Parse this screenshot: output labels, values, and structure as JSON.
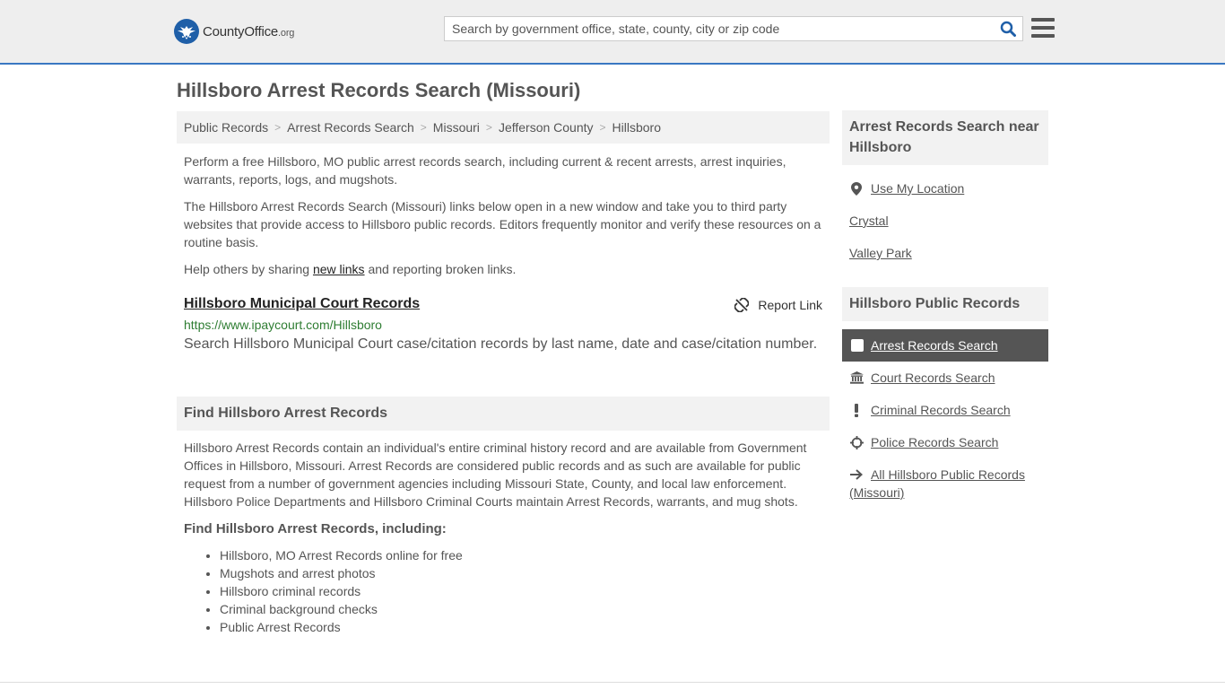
{
  "header": {
    "logo_text": "CountyOffice",
    "logo_tld": ".org",
    "search_placeholder": "Search by government office, state, county, city or zip code"
  },
  "page": {
    "title": "Hillsboro Arrest Records Search (Missouri)"
  },
  "breadcrumb": [
    "Public Records",
    "Arrest Records Search",
    "Missouri",
    "Jefferson County",
    "Hillsboro"
  ],
  "intro": {
    "p1": "Perform a free Hillsboro, MO public arrest records search, including current & recent arrests, arrest inquiries, warrants, reports, logs, and mugshots.",
    "p2": "The Hillsboro Arrest Records Search (Missouri) links below open in a new window and take you to third party websites that provide access to Hillsboro public records. Editors frequently monitor and verify these resources on a routine basis.",
    "p3_before": "Help others by sharing ",
    "p3_link": "new links",
    "p3_after": " and reporting broken links."
  },
  "result": {
    "title": "Hillsboro Municipal Court Records",
    "report_label": "Report Link",
    "url": "https://www.ipaycourt.com/Hillsboro",
    "description": "Search Hillsboro Municipal Court case/citation records by last name, date and case/citation number."
  },
  "find_section": {
    "heading": "Find Hillsboro Arrest Records",
    "body": "Hillsboro Arrest Records contain an individual's entire criminal history record and are available from Government Offices in Hillsboro, Missouri. Arrest Records are considered public records and as such are available for public request from a number of government agencies including Missouri State, County, and local law enforcement. Hillsboro Police Departments and Hillsboro Criminal Courts maintain Arrest Records, warrants, and mug shots.",
    "subheading": "Find Hillsboro Arrest Records, including:",
    "items": [
      "Hillsboro, MO Arrest Records online for free",
      "Mugshots and arrest photos",
      "Hillsboro criminal records",
      "Criminal background checks",
      "Public Arrest Records"
    ]
  },
  "sidebar": {
    "near_heading": "Arrest Records Search near Hillsboro",
    "use_location": "Use My Location",
    "near_items": [
      "Crystal",
      "Valley Park"
    ],
    "public_heading": "Hillsboro Public Records",
    "active_item": "Arrest Records Search",
    "items": [
      "Court Records Search",
      "Criminal Records Search",
      "Police Records Search",
      "All Hillsboro Public Records (Missouri)"
    ]
  },
  "colors": {
    "brand_blue": "#1f5fa8",
    "header_border": "#3a78c2",
    "url_green": "#2e7d32",
    "active_bg": "#555555"
  },
  "icons": {
    "search": "search-icon",
    "menu": "hamburger-icon",
    "report": "broken-link-icon",
    "location": "map-pin-icon",
    "court": "courthouse-icon",
    "criminal": "exclamation-icon",
    "police": "crosshair-icon",
    "all": "arrow-right-icon"
  }
}
